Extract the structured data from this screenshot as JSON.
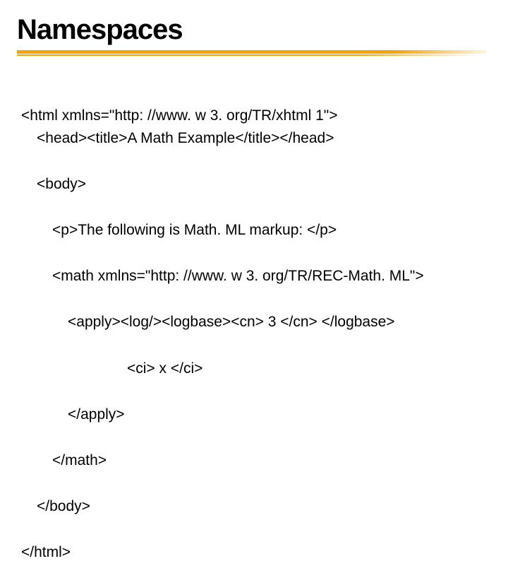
{
  "title": "Namespaces",
  "code": {
    "l1": "<html xmlns=\"http: //www. w 3. org/TR/xhtml 1\">",
    "l2": "<head><title>A Math Example</title></head>",
    "l3": "<body>",
    "l4": "<p>The following is Math. ML markup: </p>",
    "l5": "<math xmlns=\"http: //www. w 3. org/TR/REC-Math. ML\">",
    "l6": "<apply><log/><logbase><cn> 3 </cn> </logbase>",
    "l7": "<ci> x </ci>",
    "l8": "</apply>",
    "l9": "</math>",
    "l10": "</body>",
    "l11": "</html>"
  }
}
